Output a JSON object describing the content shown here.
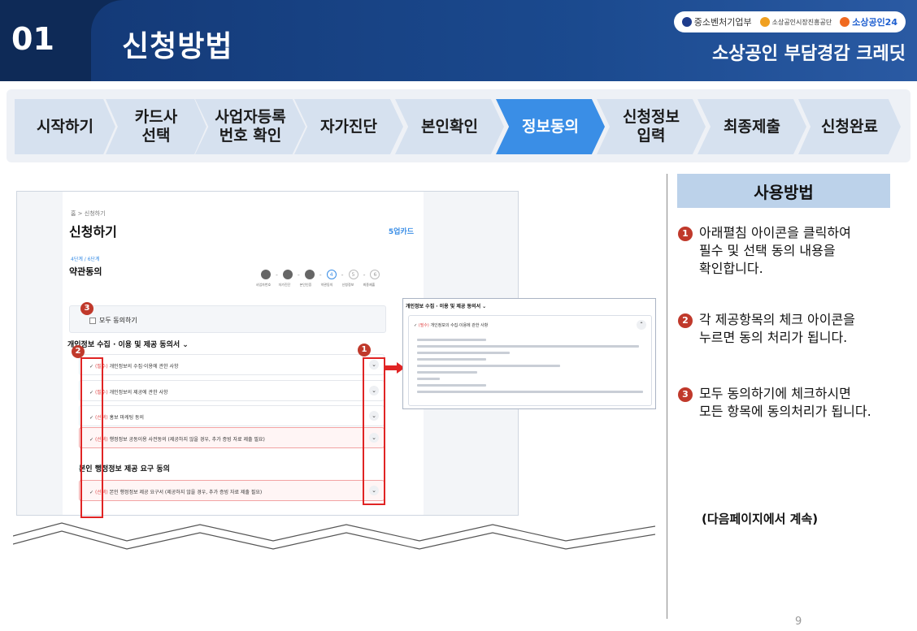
{
  "header": {
    "number": "01",
    "title": "신청방법",
    "subtitle": "소상공인 부담경감 크레딧",
    "logos": [
      "중소벤처기업부",
      "소상공인시장진흥공단",
      "소상공인24"
    ]
  },
  "steps": [
    {
      "label": "시작하기",
      "active": false
    },
    {
      "label": "카드사\n선택",
      "active": false
    },
    {
      "label": "사업자등록\n번호 확인",
      "active": false
    },
    {
      "label": "자가진단",
      "active": false
    },
    {
      "label": "본인확인",
      "active": false
    },
    {
      "label": "정보동의",
      "active": true
    },
    {
      "label": "신청정보\n입력",
      "active": false
    },
    {
      "label": "최종제출",
      "active": false
    },
    {
      "label": "신청완료",
      "active": false
    }
  ],
  "screenshot": {
    "breadcrumb": "홈 > 신청하기",
    "title": "신청하기",
    "brand": "5업카드",
    "stage_label": "4단계 / 6단계",
    "stage_title": "약관동의",
    "mini_steps": [
      "",
      "",
      "",
      "4",
      "5",
      "6"
    ],
    "mini_labels": [
      "사업자번호",
      "자가진단",
      "본인인증",
      "약관동의",
      "신청정보",
      "최종제출"
    ],
    "all_agree": "모두 동의하기",
    "section1": "개인정보 수집 · 이용 및 제공 동의서 ⌄",
    "rows": [
      {
        "tag": "(필수)",
        "text": " 개인정보의 수집·이용에 관한 사항",
        "red": false
      },
      {
        "tag": "(필수)",
        "text": " 개인정보의 제공에 관한 사항",
        "red": false
      },
      {
        "tag": "(선택)",
        "text": " 홍보 마케팅 동의",
        "red": false
      },
      {
        "tag": "(선택)",
        "text": " 행정정보 공동이용 사전동의 (제공하지 않을 경우, 추가 증빙 자료 제출 필요)",
        "red": true
      }
    ],
    "section2": "본인 행정정보 제공 요구 동의",
    "row_last": {
      "tag": "(선택)",
      "text": " 본인 행정정보 제공 요구서 (제공하지 않을 경우, 추가 증빙 자료 제출 필요)"
    },
    "badges": [
      "3",
      "2",
      "1"
    ]
  },
  "popup": {
    "title": "개인정보 수집 · 이용 및 제공 동의서 ⌄",
    "head_tag": "(필수)",
    "head_text": " 개인정보의 수집·이용에 관한 사항"
  },
  "panel": {
    "heading": "사용방법",
    "instructions": [
      {
        "num": "1",
        "text": "아래펼침 아이콘을 클릭하여\n필수 및 선택 동의 내용을\n확인합니다."
      },
      {
        "num": "2",
        "text": "각 제공항목의  체크 아이콘을\n누르면 동의 처리가 됩니다."
      },
      {
        "num": "3",
        "text": "모두 동의하기에 체크하시면\n모든 항목에 동의처리가 됩니다."
      }
    ],
    "continued": "(다음페이지에서 계속)"
  },
  "page_number": "9",
  "colors": {
    "navy": "#0e2a57",
    "active_step": "#3a8ee6",
    "step": "#d6e1ef",
    "badge": "#c0392b",
    "highlight": "#e02424"
  }
}
